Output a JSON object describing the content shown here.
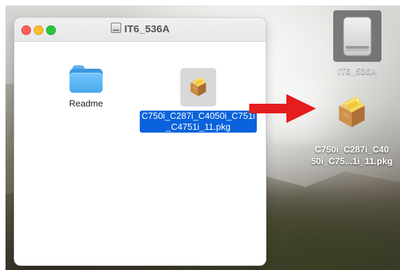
{
  "window": {
    "title": "IT6_536A"
  },
  "finder_items": [
    {
      "label": "Readme",
      "icon": "folder-icon"
    },
    {
      "label": "C750i_C287i_C4050i_C751i_C4751i_11.pkg",
      "label_line_1": "C750i_C287i_C4050i_C751i",
      "label_line_2": "_C4751i_11.pkg",
      "icon": "package-icon",
      "selected": true
    }
  ],
  "desktop": {
    "drive_label": "IT6_536A",
    "drive_icon": "external-drive-icon",
    "package_label_line_1": "C750i_C287i_C40",
    "package_label_line_2": "50i_C75...1i_11.pkg",
    "package_icon": "package-icon",
    "arrow_icon": "right-arrow-icon"
  },
  "colors": {
    "selection_blue": "#0a63dc",
    "arrow_red": "#e51d1d",
    "folder_blue": "#4aa8ea",
    "package_tan": "#c98f4a"
  }
}
